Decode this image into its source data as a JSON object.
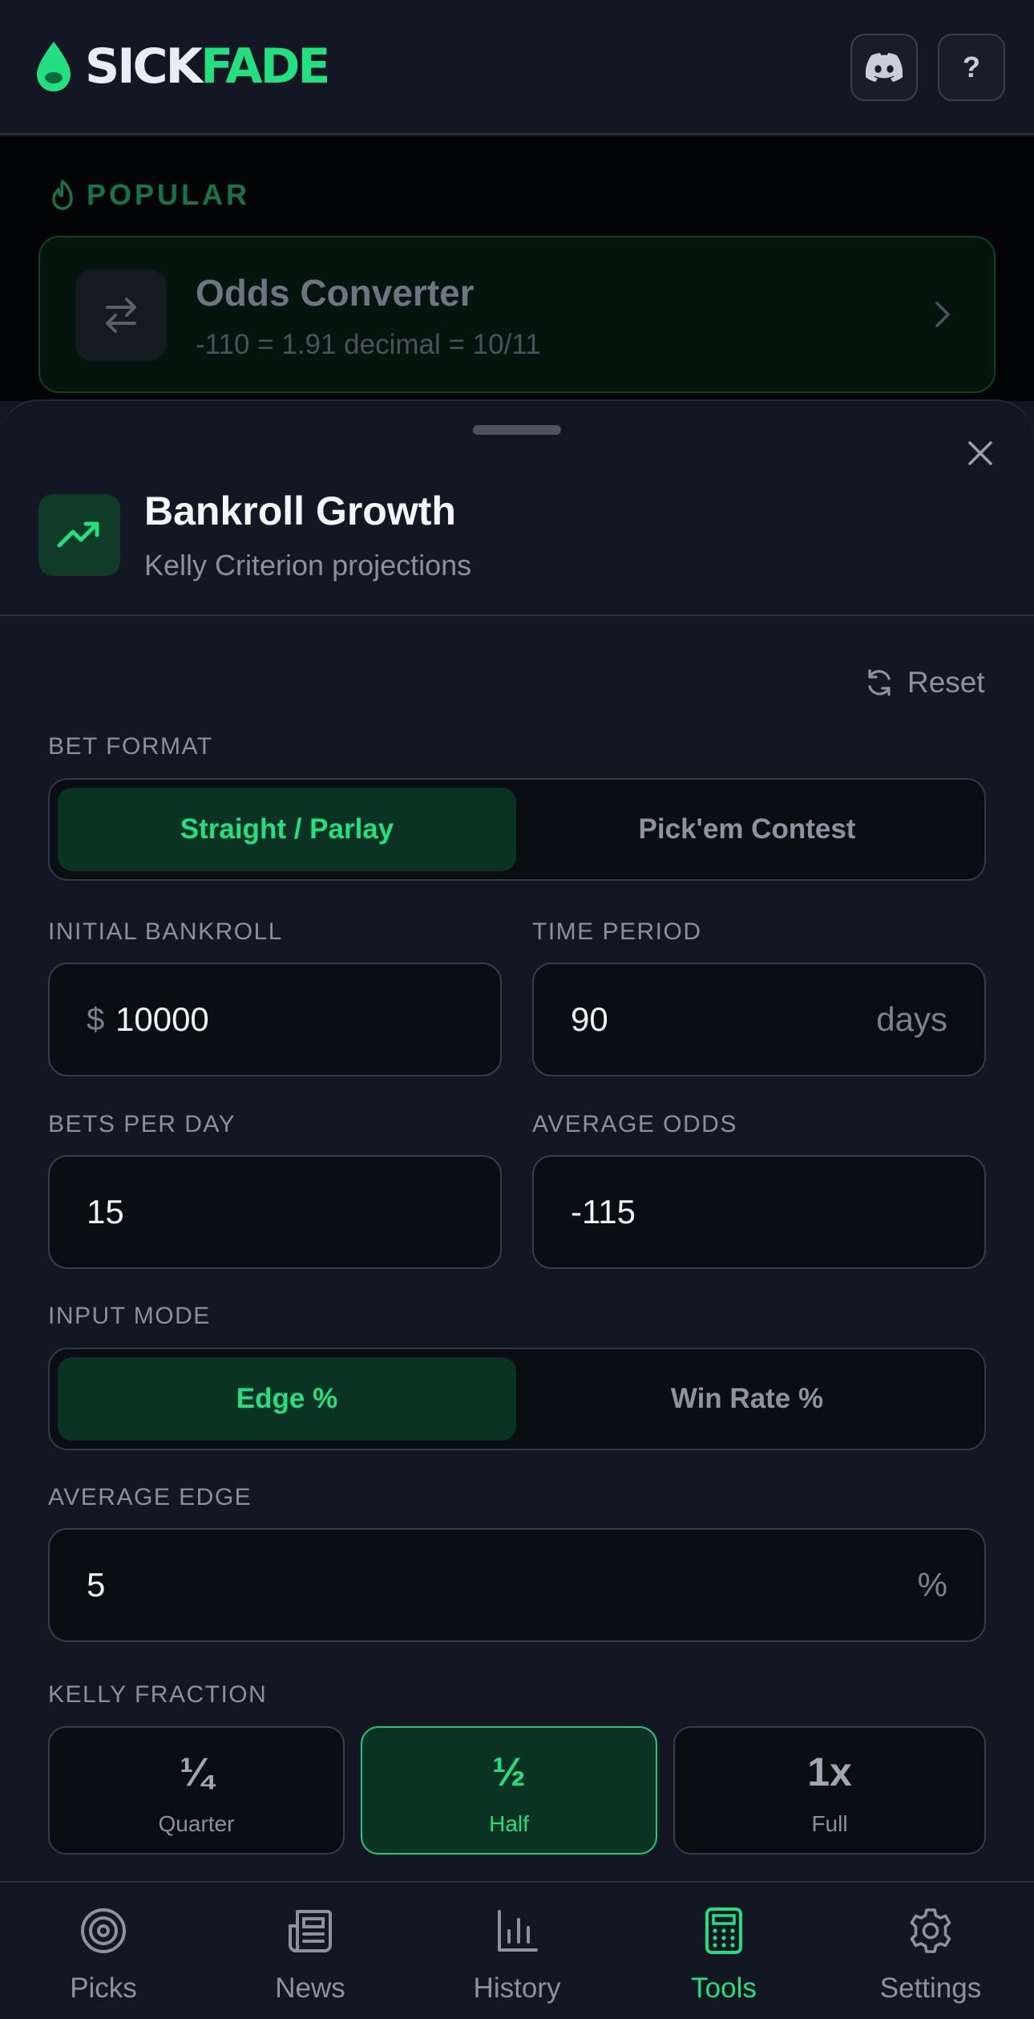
{
  "header": {
    "logo_part1": "SICK",
    "logo_part2": "FADE",
    "discord_icon": "discord-icon",
    "help_label": "?"
  },
  "background": {
    "section_label": "POPULAR",
    "card": {
      "title": "Odds Converter",
      "subtitle": "-110 = 1.91 decimal = 10/11"
    }
  },
  "sheet": {
    "title": "Bankroll Growth",
    "subtitle": "Kelly Criterion projections",
    "reset_label": "Reset",
    "bet_format": {
      "label": "BET FORMAT",
      "options": [
        "Straight / Parlay",
        "Pick'em Contest"
      ],
      "selected": "Straight / Parlay"
    },
    "initial_bankroll": {
      "label": "INITIAL BANKROLL",
      "prefix": "$",
      "value": "10000"
    },
    "time_period": {
      "label": "TIME PERIOD",
      "value": "90",
      "suffix": "days"
    },
    "bets_per_day": {
      "label": "BETS PER DAY",
      "value": "15"
    },
    "average_odds": {
      "label": "AVERAGE ODDS",
      "value": "-115"
    },
    "input_mode": {
      "label": "INPUT MODE",
      "options": [
        "Edge %",
        "Win Rate %"
      ],
      "selected": "Edge %"
    },
    "average_edge": {
      "label": "AVERAGE EDGE",
      "value": "5",
      "suffix": "%"
    },
    "kelly_fraction": {
      "label": "KELLY FRACTION",
      "options": [
        {
          "value": "¼",
          "name": "Quarter"
        },
        {
          "value": "½",
          "name": "Half"
        },
        {
          "value": "1x",
          "name": "Full"
        }
      ],
      "selected": "Half"
    }
  },
  "tabbar": {
    "tabs": [
      {
        "label": "Picks",
        "icon": "target-icon"
      },
      {
        "label": "News",
        "icon": "newspaper-icon"
      },
      {
        "label": "History",
        "icon": "bar-chart-icon"
      },
      {
        "label": "Tools",
        "icon": "calculator-icon"
      },
      {
        "label": "Settings",
        "icon": "gear-icon"
      }
    ],
    "active": "Tools"
  },
  "colors": {
    "accent": "#22e07f",
    "background": "#121723",
    "field_background": "#0a0d12",
    "active_segment": "#0b3324"
  }
}
